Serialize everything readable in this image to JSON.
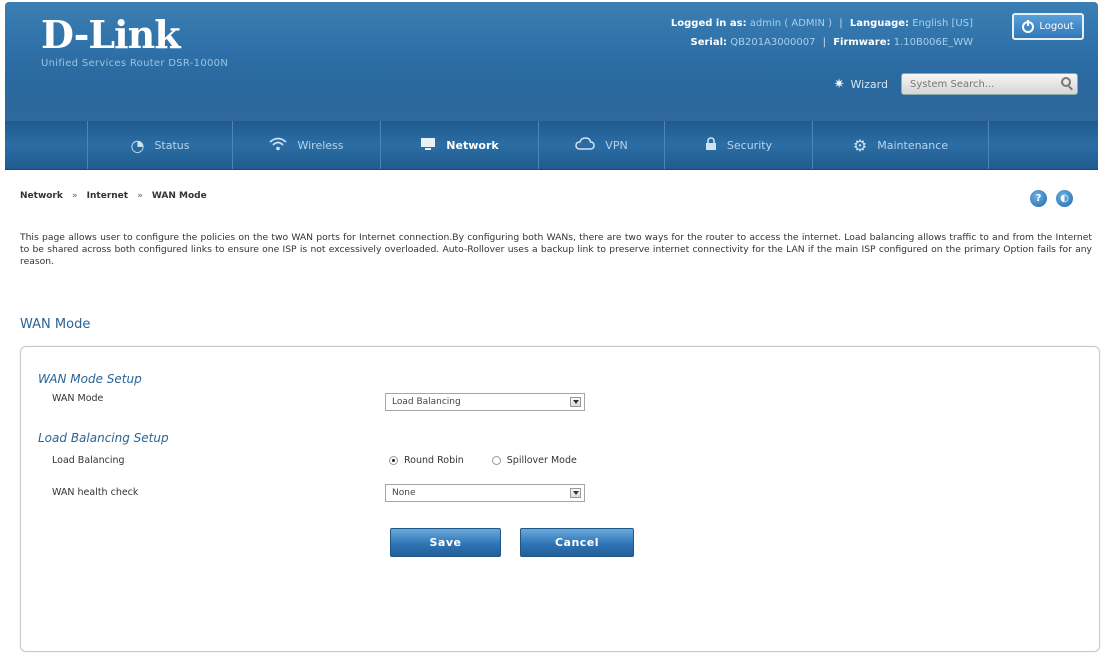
{
  "header": {
    "logo": "D-Link",
    "product": "Unified Services Router    DSR-1000N",
    "logged_in_label": "Logged in as:",
    "logged_in_value": "admin ( ADMIN )",
    "language_label": "Language:",
    "language_value": "English [US]",
    "serial_label": "Serial:",
    "serial_value": "QB201A3000007",
    "firmware_label": "Firmware:",
    "firmware_value": "1.10B006E_WW",
    "logout_label": "Logout",
    "wizard_label": "Wizard",
    "search_placeholder": "System Search..."
  },
  "nav": {
    "items": [
      {
        "label": "Status",
        "icon": "gauge-icon"
      },
      {
        "label": "Wireless",
        "icon": "wifi-icon"
      },
      {
        "label": "Network",
        "icon": "monitor-icon",
        "active": true
      },
      {
        "label": "VPN",
        "icon": "cloud-icon"
      },
      {
        "label": "Security",
        "icon": "lock-icon"
      },
      {
        "label": "Maintenance",
        "icon": "gears-icon"
      }
    ]
  },
  "breadcrumb": {
    "items": [
      "Network",
      "Internet",
      "WAN Mode"
    ],
    "separator": "»"
  },
  "description": "This page allows user to configure the policies on the two WAN ports for Internet connection.By configuring both WANs, there are two ways for the router to access the internet. Load balancing allows traffic to and from the Internet to be shared across both configured links to ensure one ISP is not excessively overloaded. Auto-Rollover uses a backup link to preserve internet connectivity for the LAN if the main ISP configured on the primary Option fails for any reason.",
  "section_title": "WAN Mode",
  "form": {
    "wan_mode_setup_title": "WAN Mode Setup",
    "wan_mode_label": "WAN Mode",
    "wan_mode_value": "Load Balancing",
    "load_balancing_setup_title": "Load Balancing Setup",
    "load_balancing_label": "Load Balancing",
    "option_round_robin": "Round Robin",
    "option_spillover": "Spillover Mode",
    "selected_option": "Round Robin",
    "health_check_label": "WAN health check",
    "health_check_value": "None",
    "save_label": "Save",
    "cancel_label": "Cancel"
  },
  "colors": {
    "header_blue": "#2d6fa6",
    "nav_blue": "#1f5b8e",
    "section_title": "#2a6496"
  }
}
